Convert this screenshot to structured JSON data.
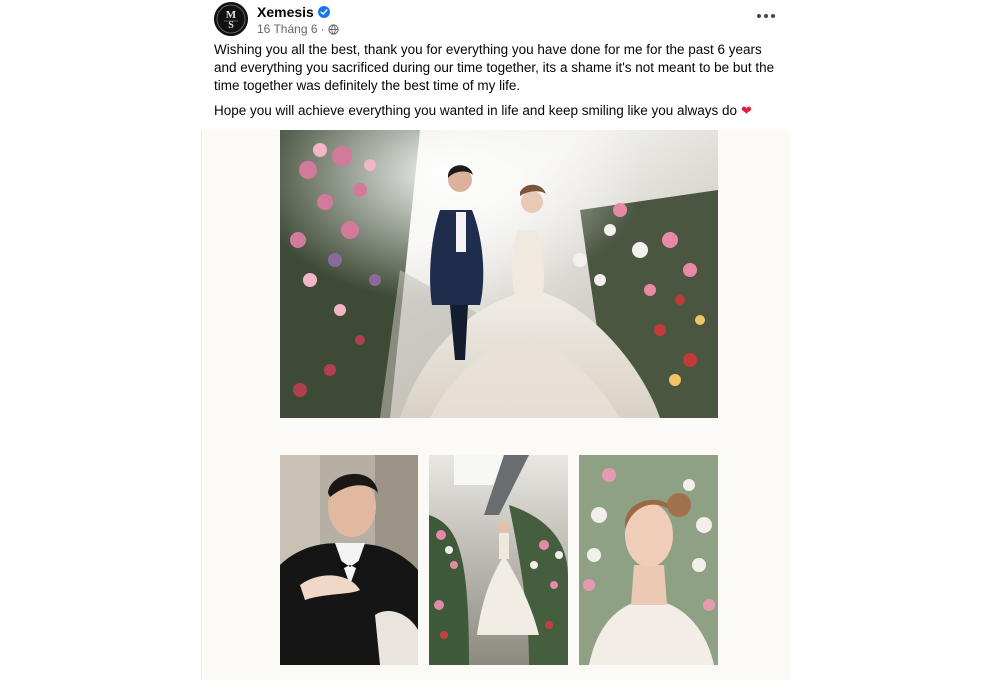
{
  "post": {
    "author": "Xemesis",
    "date": "16 Tháng 6",
    "separator": "·",
    "privacy_icon": "globe-icon",
    "verified_icon": "verified-badge-icon",
    "more_icon": "more-options-icon",
    "caption": {
      "paragraph_1": "Wishing you all the best, thank you for everything you have done for me for the past 6 years and everything you sacrificed during our time together, its a shame it's not meant to be but the time together was definitely the best time of my life.",
      "paragraph_2": "Hope you will achieve everything you wanted in life and keep smiling like you always do",
      "emoji": "heart-emoji"
    },
    "photos": [
      {
        "subject": "wedding-couple-on-flower-staircase"
      },
      {
        "subject": "groom-in-tuxedo-portrait"
      },
      {
        "subject": "bride-on-flower-staircase"
      },
      {
        "subject": "bride-profile-portrait"
      }
    ]
  },
  "colors": {
    "verified": "#1877f2",
    "heart": "#e41e3f",
    "text": "#050505",
    "meta": "#65676b"
  }
}
